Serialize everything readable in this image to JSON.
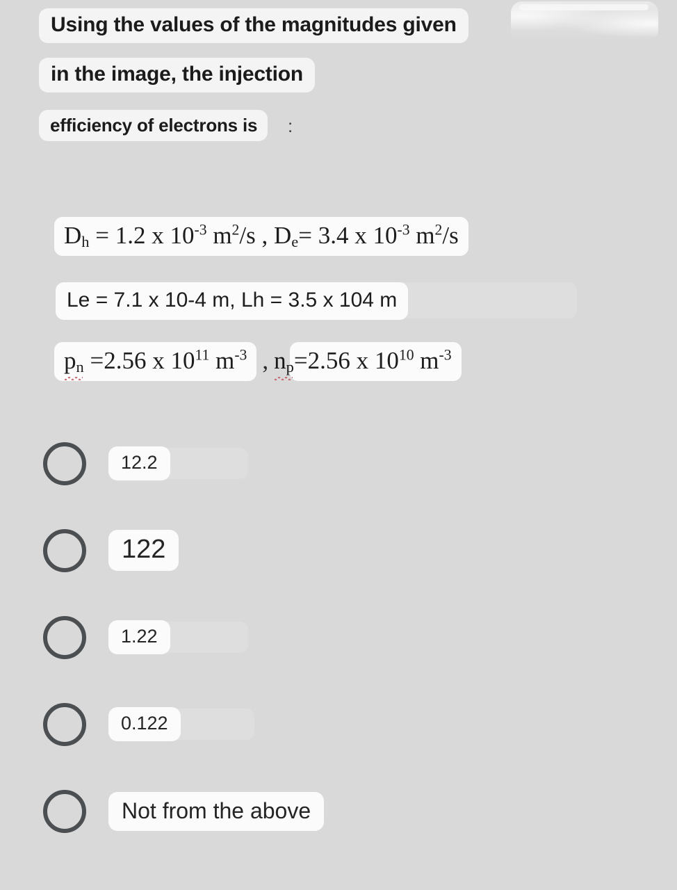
{
  "background_color": "#d9d9d9",
  "question": {
    "lines": [
      "Using the values of the magnitudes given",
      "in the image, the injection",
      "efficiency of electrons is"
    ],
    "stray_glyph": ":"
  },
  "given_values": {
    "row1": {
      "left": {
        "symbol": "D",
        "subscript": "h",
        "equals": "=",
        "mantissa": "1.2 x 10",
        "exponent": "-3",
        "unit_base": " m",
        "unit_sup": "2",
        "unit_tail": "/s"
      },
      "separator": ",",
      "right": {
        "symbol": "D",
        "subscript": "e",
        "equals": "=",
        "mantissa": "3.4 x 10",
        "exponent": "-3",
        "unit_base": " m",
        "unit_sup": "2",
        "unit_tail": "/s"
      }
    },
    "row2": {
      "text": "Le = 7.1 x 10-4 m, Lh = 3.5 x 104 m"
    },
    "row3": {
      "left": {
        "symbol": "p",
        "subscript": "n",
        "equals": "=",
        "mantissa": "2.56 x 10",
        "exponent": "11",
        "unit_base": " m",
        "unit_sup": "-3",
        "misspelled": true
      },
      "separator": ",",
      "right": {
        "symbol": "n",
        "subscript": "p",
        "equals": "=",
        "mantissa": "2.56 x 10",
        "exponent": "10",
        "unit_base": " m",
        "unit_sup": "-3",
        "misspelled": true
      }
    }
  },
  "options": [
    {
      "label": "12.2",
      "size": "sz-sm",
      "selected": false,
      "ghost_width": 98
    },
    {
      "label": "122",
      "size": "sz-lg",
      "selected": false,
      "ghost_width": 0
    },
    {
      "label": "1.22",
      "size": "sz-sm",
      "selected": false,
      "ghost_width": 98
    },
    {
      "label": "0.122",
      "size": "sz-sm",
      "selected": false,
      "ghost_width": 92
    },
    {
      "label": "Not from the above",
      "size": "sz-md",
      "selected": false,
      "ghost_width": 0
    }
  ]
}
